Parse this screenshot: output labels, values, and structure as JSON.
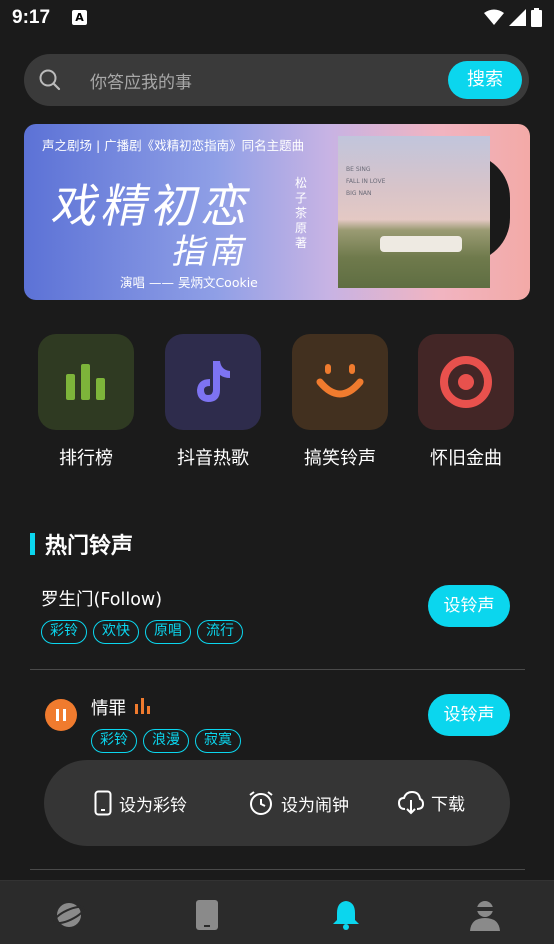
{
  "status_bar": {
    "time": "9:17",
    "notification_icon_letter": "A"
  },
  "search": {
    "placeholder": "你答应我的事",
    "button_label": "搜索"
  },
  "banner": {
    "top_line": "声之剧场 | 广播剧《戏精初恋指南》同名主题曲",
    "calligraphy_line1": "戏精初恋",
    "calligraphy_line2": "指南",
    "vertical_credit": "松子茶原著",
    "singer_line": "演唱 —— 吴炳文Cookie",
    "cover_caption": "BE SING\nFALL IN LOVE\nBIG NAN"
  },
  "quick_entries": [
    {
      "label": "排行榜",
      "icon": "bar-chart-icon",
      "color": "#7db43a"
    },
    {
      "label": "抖音热歌",
      "icon": "tiktok-icon",
      "color": "#7d73f2"
    },
    {
      "label": "搞笑铃声",
      "icon": "smile-icon",
      "color": "#f07b2e"
    },
    {
      "label": "怀旧金曲",
      "icon": "target-icon",
      "color": "#e8514d"
    }
  ],
  "section": {
    "title": "热门铃声"
  },
  "songs": [
    {
      "name": "罗生门(Follow)",
      "tags": [
        "彩铃",
        "欢快",
        "原唱",
        "流行"
      ],
      "button": "设铃声"
    },
    {
      "name": "情罪",
      "tags": [
        "彩铃",
        "浪漫",
        "寂寞"
      ],
      "button": "设铃声",
      "playing": true
    }
  ],
  "song_actions": [
    {
      "label": "设为彩铃",
      "icon": "phone-icon"
    },
    {
      "label": "设为闹钟",
      "icon": "alarm-clock-icon"
    },
    {
      "label": "下载",
      "icon": "download-cloud-icon"
    }
  ],
  "tab_bar": {
    "active_index": 2,
    "accent": "#0bd6ee",
    "tabs": [
      {
        "icon": "planet-icon"
      },
      {
        "icon": "phone-icon"
      },
      {
        "icon": "bell-icon"
      },
      {
        "icon": "user-icon"
      }
    ]
  },
  "colors": {
    "accent": "#0bd6ee",
    "orange": "#f07b2e",
    "background": "#1b1b1b"
  }
}
